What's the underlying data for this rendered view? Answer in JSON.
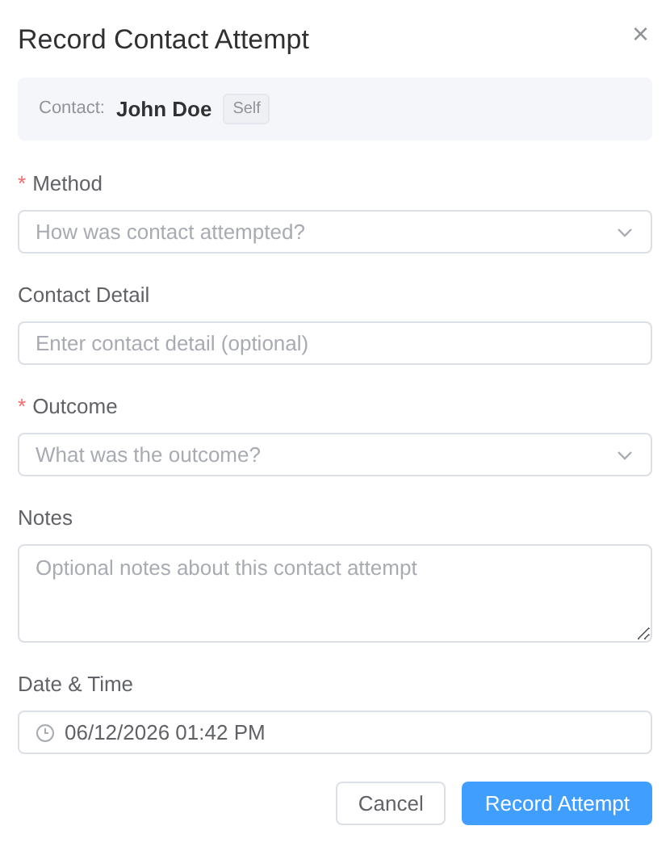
{
  "dialog": {
    "title": "Record Contact Attempt",
    "close": "×"
  },
  "contact": {
    "label": "Contact:",
    "name": "John Doe",
    "tag": "Self"
  },
  "fields": [
    {
      "kind": "select",
      "label": "Method",
      "required_mark": "*",
      "placeholder": "How was contact attempted?"
    },
    {
      "kind": "input",
      "label": "Contact Detail",
      "placeholder": "Enter contact detail (optional)"
    },
    {
      "kind": "select",
      "label": "Outcome",
      "required_mark": "*",
      "placeholder": "What was the outcome?"
    },
    {
      "kind": "textarea",
      "label": "Notes",
      "placeholder": "Optional notes about this contact attempt"
    },
    {
      "kind": "datetime",
      "label": "Date & Time",
      "value": "06/12/2026 01:42 PM"
    }
  ],
  "buttons": [
    {
      "label": "Cancel",
      "kind": "secondary"
    },
    {
      "label": "Record Attempt",
      "kind": "primary"
    }
  ]
}
